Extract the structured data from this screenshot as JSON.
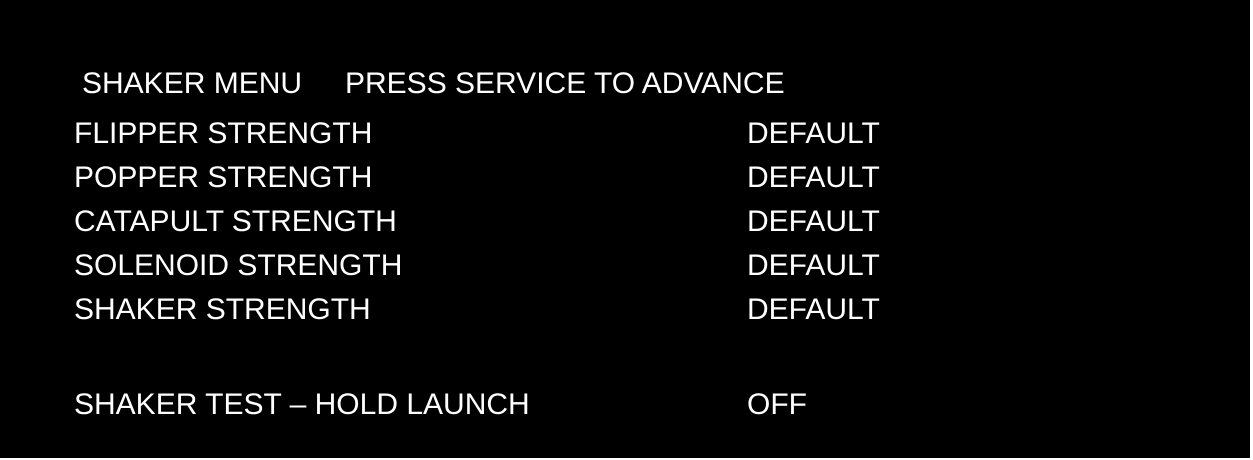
{
  "header": {
    "title": "SHAKER MENU",
    "hint": "PRESS SERVICE TO ADVANCE"
  },
  "settings": [
    {
      "label": "FLIPPER STRENGTH",
      "value": "DEFAULT"
    },
    {
      "label": "POPPER STRENGTH",
      "value": "DEFAULT"
    },
    {
      "label": "CATAPULT STRENGTH",
      "value": "DEFAULT"
    },
    {
      "label": "SOLENOID STRENGTH",
      "value": "DEFAULT"
    },
    {
      "label": "SHAKER STRENGTH",
      "value": "DEFAULT"
    }
  ],
  "test": {
    "label": "SHAKER TEST – HOLD LAUNCH",
    "value": "OFF"
  },
  "colors": {
    "background": "#000000",
    "text": "#ffffff"
  }
}
